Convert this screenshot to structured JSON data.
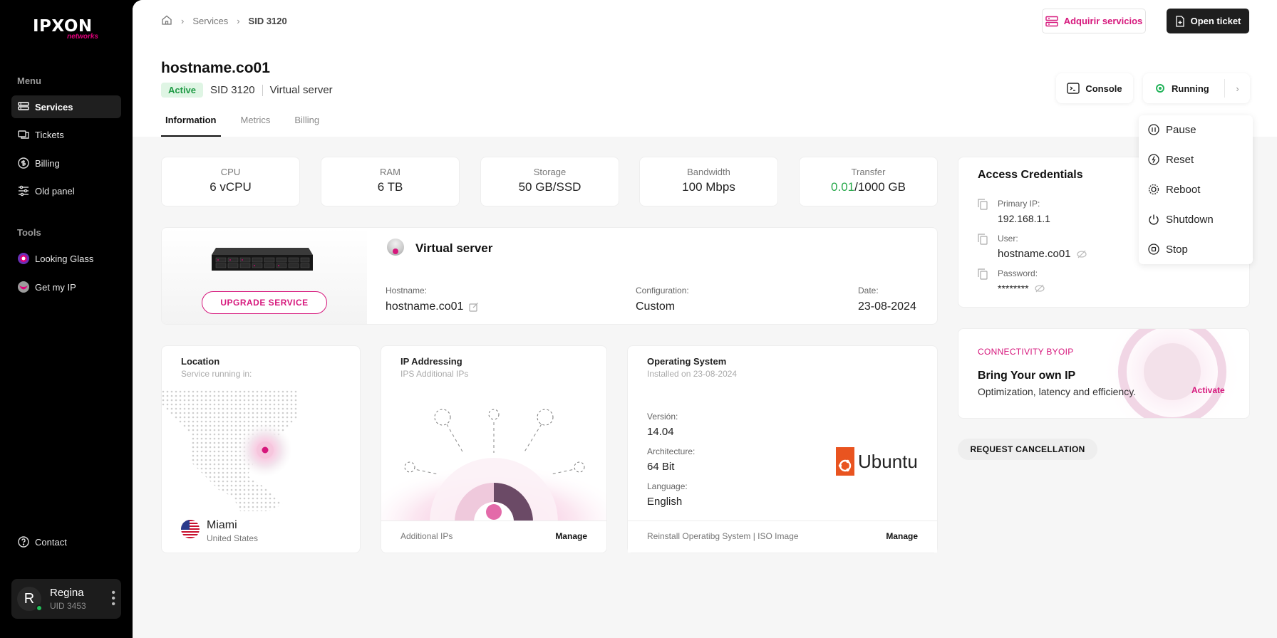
{
  "brand": {
    "name": "IPXON",
    "tagline": "networks",
    "accent": "#d6177c"
  },
  "sidebar": {
    "menu_heading": "Menu",
    "items": [
      {
        "label": "Services",
        "icon": "services-icon",
        "active": true
      },
      {
        "label": "Tickets",
        "icon": "tickets-icon"
      },
      {
        "label": "Billing",
        "icon": "billing-icon"
      },
      {
        "label": "Old panel",
        "icon": "sliders-icon"
      }
    ],
    "tools_heading": "Tools",
    "tools": [
      {
        "label": "Looking Glass",
        "icon": "looking-glass-icon"
      },
      {
        "label": "Get my IP",
        "icon": "get-my-ip-icon"
      }
    ],
    "contact": "Contact",
    "user": {
      "initial": "R",
      "name": "Regina",
      "uid": "UID  3453",
      "status": "online"
    }
  },
  "topbar": {
    "breadcrumb": [
      "Services",
      "SID 3120"
    ],
    "acquire_label": "Adquirir servicios",
    "ticket_label": "Open ticket"
  },
  "header": {
    "hostname": "hostname.co01",
    "status_badge": "Active",
    "sid": "SID  3120",
    "type": "Virtual server",
    "tabs": [
      "Information",
      "Metrics",
      "Billing"
    ],
    "console_label": "Console",
    "running_label": "Running"
  },
  "power_menu": [
    {
      "label": "Pause",
      "icon": "pause-icon"
    },
    {
      "label": "Reset",
      "icon": "reset-icon"
    },
    {
      "label": "Reboot",
      "icon": "reboot-icon"
    },
    {
      "label": "Shutdown",
      "icon": "power-icon"
    },
    {
      "label": "Stop",
      "icon": "stop-icon"
    }
  ],
  "stats": [
    {
      "label": "CPU",
      "value": "6 vCPU"
    },
    {
      "label": "RAM",
      "value": "6 TB"
    },
    {
      "label": "Storage",
      "value": "50 GB/SSD"
    },
    {
      "label": "Bandwidth",
      "value": "100 Mbps"
    },
    {
      "label": "Transfer",
      "used": "0.01",
      "total": "/1000 GB"
    }
  ],
  "server": {
    "upgrade_label": "UPGRADE SERVICE",
    "title": "Virtual server",
    "hostname_label": "Hostname:",
    "hostname": "hostname.co01",
    "config_label": "Configuration:",
    "config": "Custom",
    "date_label": "Date:",
    "date": "23-08-2024"
  },
  "location": {
    "title": "Location",
    "subtitle": "Service running in:",
    "city": "Miami",
    "country": "United States"
  },
  "ip_addressing": {
    "title": "IP Addressing",
    "subtitle": "IPS Additional IPs",
    "footer_left": "Additional IPs",
    "footer_action": "Manage"
  },
  "os": {
    "title": "Operating System",
    "subtitle": "Installed on 23-08-2024",
    "version_label": "Versión:",
    "version": "14.04",
    "arch_label": "Architecture:",
    "arch": "64 Bit",
    "lang_label": "Language:",
    "lang": "English",
    "logo_text": "Ubuntu",
    "footer_left": "Reinstall Operatibg System   |   ISO Image",
    "footer_action": "Manage"
  },
  "access": {
    "title": "Access Credentials",
    "ip_label": "Primary IP:",
    "ip": "192.168.1.1",
    "user_label": "User:",
    "user": "hostname.co01",
    "pass_label": "Password:",
    "pass": "********"
  },
  "byoip": {
    "eyebrow": "CONNECTIVITY BYOIP",
    "title": "Bring Your own IP",
    "desc": "Optimization, latency and efficiency.",
    "action": "Activate"
  },
  "cancel_label": "REQUEST CANCELLATION"
}
